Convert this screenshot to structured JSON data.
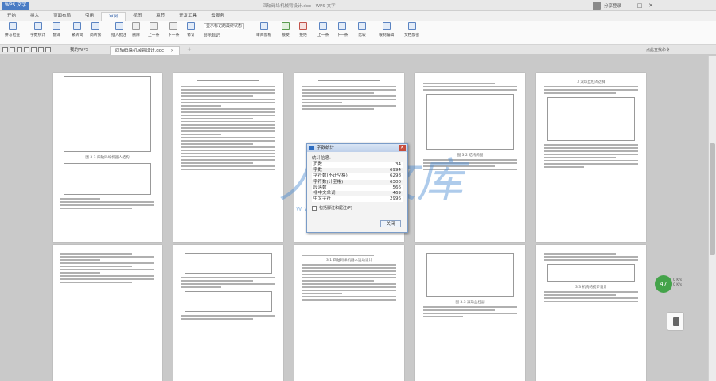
{
  "app": {
    "brand": "WPS 文字",
    "title": "四轴码垛机械臂设计.doc - WPS 文字",
    "user": "分享登录",
    "controls": [
      "—",
      "□",
      "✕"
    ]
  },
  "menu": {
    "tabs": [
      "开始",
      "插入",
      "页面布局",
      "引用",
      "审阅",
      "视图",
      "章节",
      "开发工具",
      "云服务"
    ],
    "active": "审阅"
  },
  "ribbon": {
    "buttons": [
      "拼写检查",
      "字数统计",
      "翻译",
      "繁转简",
      "简转繁",
      "插入批注",
      "删除",
      "上一条",
      "下一条",
      "修订",
      "审阅窗格",
      "接受",
      "拒绝",
      "上一条",
      "下一条",
      "比较",
      "限制编辑",
      "文档加密"
    ],
    "show_markup": "显示标记的最终状态",
    "show_markup_sub": "显示标记"
  },
  "tabs": {
    "items": [
      {
        "label": "我的WPS"
      },
      {
        "label": "四轴码垛机械臂设计.doc"
      }
    ],
    "right": "点此查找命令"
  },
  "dialog": {
    "title": "字数统计",
    "section": "统计信息:",
    "rows": [
      {
        "label": "页数",
        "value": "34"
      },
      {
        "label": "字数",
        "value": "6994"
      },
      {
        "label": "字符数(不计空格)",
        "value": "6298"
      },
      {
        "label": "字符数(计空格)",
        "value": "6300"
      },
      {
        "label": "段落数",
        "value": "566"
      },
      {
        "label": "非中文单词",
        "value": "469"
      },
      {
        "label": "中文字符",
        "value": "2996"
      }
    ],
    "checkbox": "包括脚注和尾注(F)",
    "close": "关闭"
  },
  "watermark": {
    "text": "人人文库",
    "url": "www.renrendoc.com"
  },
  "float": {
    "value": "47",
    "stats": [
      "0 K/s",
      "0 K/s"
    ]
  },
  "pages": {
    "figure_captions": [
      "图 3-1 四轴码垛机器人结构",
      "图 3.2 结构简图",
      "图 3.3 滚珠丝杠副"
    ],
    "headings": [
      "3 滚珠丝杠的选择",
      "3.1 四轴码垛机器人运动设计",
      "3.3 机构的初步设计"
    ]
  },
  "colors": {
    "accent": "#2f5ea8",
    "ribbon_bg": "#fafafa",
    "canvas": "#c9c9c9",
    "dialog_close": "#c64d3c"
  }
}
